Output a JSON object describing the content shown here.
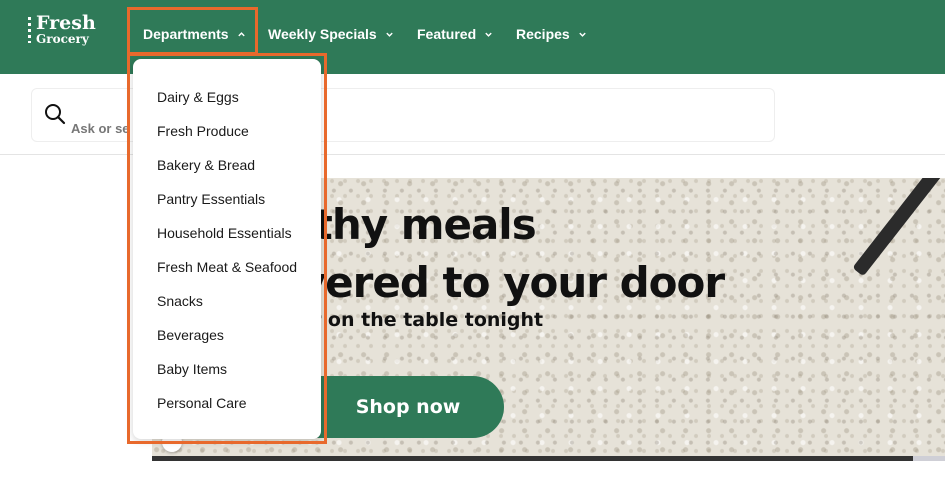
{
  "logo": {
    "line1": "Fresh",
    "line2": "Grocery"
  },
  "nav": {
    "items": [
      {
        "label": "Departments",
        "icon": "chevron-up-icon"
      },
      {
        "label": "Weekly Specials",
        "icon": "chevron-down-icon"
      },
      {
        "label": "Featured",
        "icon": "chevron-down-icon"
      },
      {
        "label": "Recipes",
        "icon": "chevron-down-icon"
      }
    ]
  },
  "search": {
    "placeholder": "Ask or se",
    "icon": "search-icon"
  },
  "departments_menu": {
    "items": [
      "Dairy & Eggs",
      "Fresh Produce",
      "Bakery & Bread",
      "Pantry Essentials",
      "Household Essentials",
      "Fresh Meat & Seafood",
      "Snacks",
      "Beverages",
      "Baby Items",
      "Personal Care"
    ]
  },
  "banner": {
    "headline1": "althy meals",
    "headline2": "livered to your door",
    "subheadline": "nner on the table tonight",
    "cta": "Shop now",
    "progress": 0.96
  },
  "colors": {
    "brand_green": "#2f7a58",
    "highlight": "#e8692c"
  }
}
